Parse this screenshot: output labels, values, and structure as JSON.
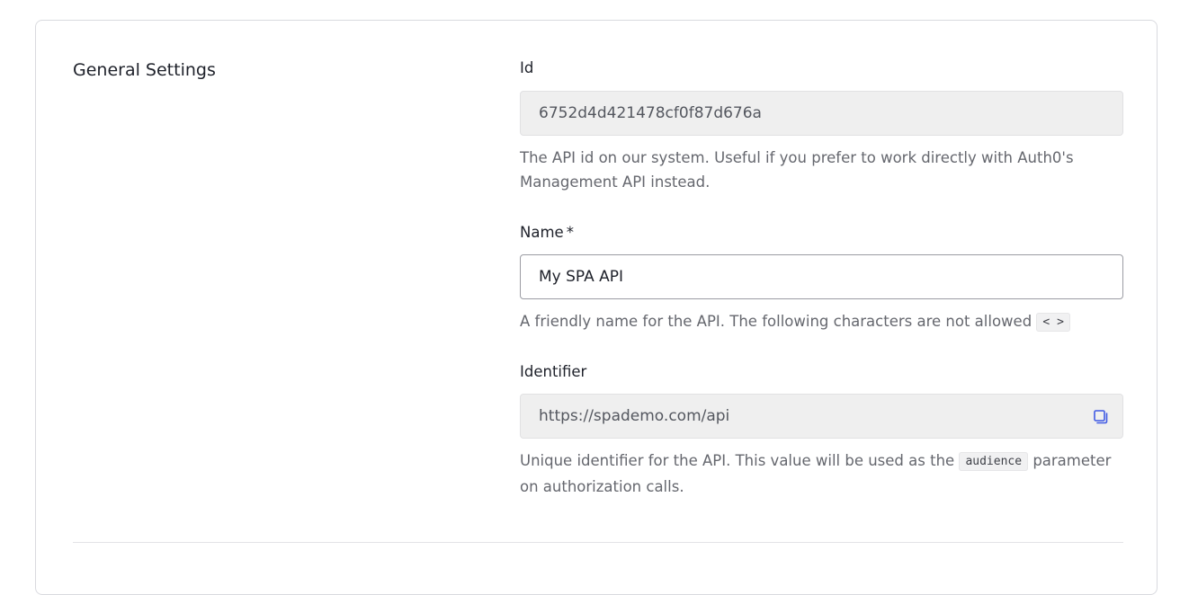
{
  "section": {
    "title": "General Settings"
  },
  "fields": {
    "id": {
      "label": "Id",
      "value": "6752d4d421478cf0f87d676a",
      "help": "The API id on our system. Useful if you prefer to work directly with Auth0's Management API instead."
    },
    "name": {
      "label": "Name",
      "required_marker": "*",
      "value": "My SPA API",
      "help_prefix": "A friendly name for the API. The following characters are not allowed",
      "disallowed_chars": "< >"
    },
    "identifier": {
      "label": "Identifier",
      "value": "https://spademo.com/api",
      "copy_icon": "copy-icon",
      "help_prefix": "Unique identifier for the API. This value will be used as the",
      "help_code": "audience",
      "help_suffix": "parameter on authorization calls."
    }
  },
  "colors": {
    "accent": "#3f59e4",
    "readonly_bg": "#efefef",
    "border": "#d9dadf"
  }
}
